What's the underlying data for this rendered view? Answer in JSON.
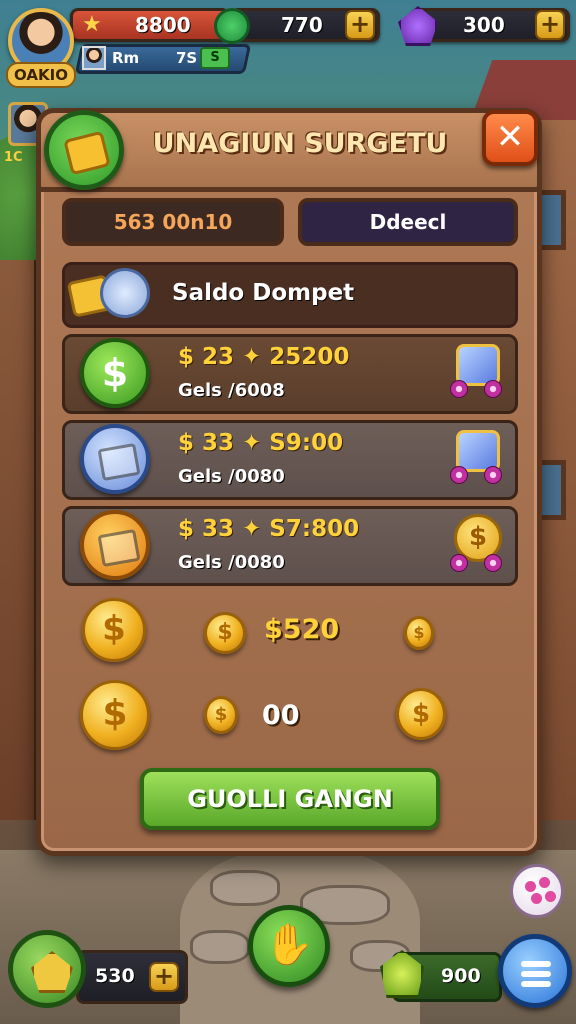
{
  "hud": {
    "level_badge": "OAKIO",
    "coins": "8800",
    "gems": "770",
    "purple_gems": "300",
    "player_tag": "Rm",
    "player_sub_value": "7S",
    "player_sub_badge": "S",
    "secondary_badge": "1C"
  },
  "dialog": {
    "title": "UNAGIUN SURGETU",
    "info_left": "563 00n10",
    "info_right": "Ddeecl",
    "wallet_label": "Saldo Dompet",
    "items": [
      {
        "price": "$ 23 ✦ 25200",
        "sub": "Gels /6008",
        "icon": "dollar-icon",
        "reward": "cube-icon"
      },
      {
        "price": "$ 33 ✦ S9:00",
        "sub": "Gels /0080",
        "icon": "box-icon",
        "reward": "cube-icon"
      },
      {
        "price": "$ 33 ✦ S7:800",
        "sub": "Gels /0080",
        "icon": "box-icon",
        "reward": "coin-icon"
      }
    ],
    "coin_amount_1": "$520",
    "coin_amount_2": "00",
    "claim_button": "GUOLLI GANGN",
    "close_label": "✕"
  },
  "bottom": {
    "left_value": "530",
    "right_value": "900",
    "center_icon": "hand-icon",
    "menu_icon": "menu-icon"
  },
  "colors": {
    "price_gold": "#ffd23a",
    "claim_green": "#5aa82a",
    "close_orange": "#e0501a",
    "panel_brown": "#9a6848"
  },
  "symbols": {
    "plus": "+",
    "dollar": "$"
  }
}
